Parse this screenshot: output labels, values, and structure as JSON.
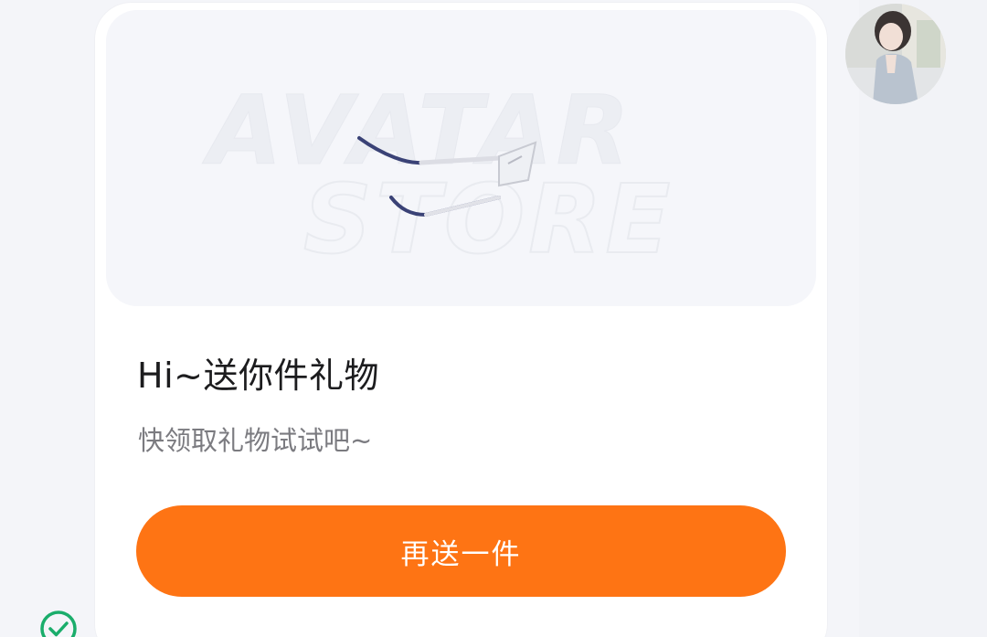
{
  "gift_card": {
    "banner_watermark_line1": "AVATAR",
    "banner_watermark_line2": "STORE",
    "title": "Hi~送你件礼物",
    "subtitle": "快领取礼物试试吧~",
    "send_again_label": "再送一件"
  },
  "colors": {
    "accent": "#fe7414",
    "status_green": "#1aad6b"
  },
  "icons": {
    "status": "check-circle-icon"
  }
}
